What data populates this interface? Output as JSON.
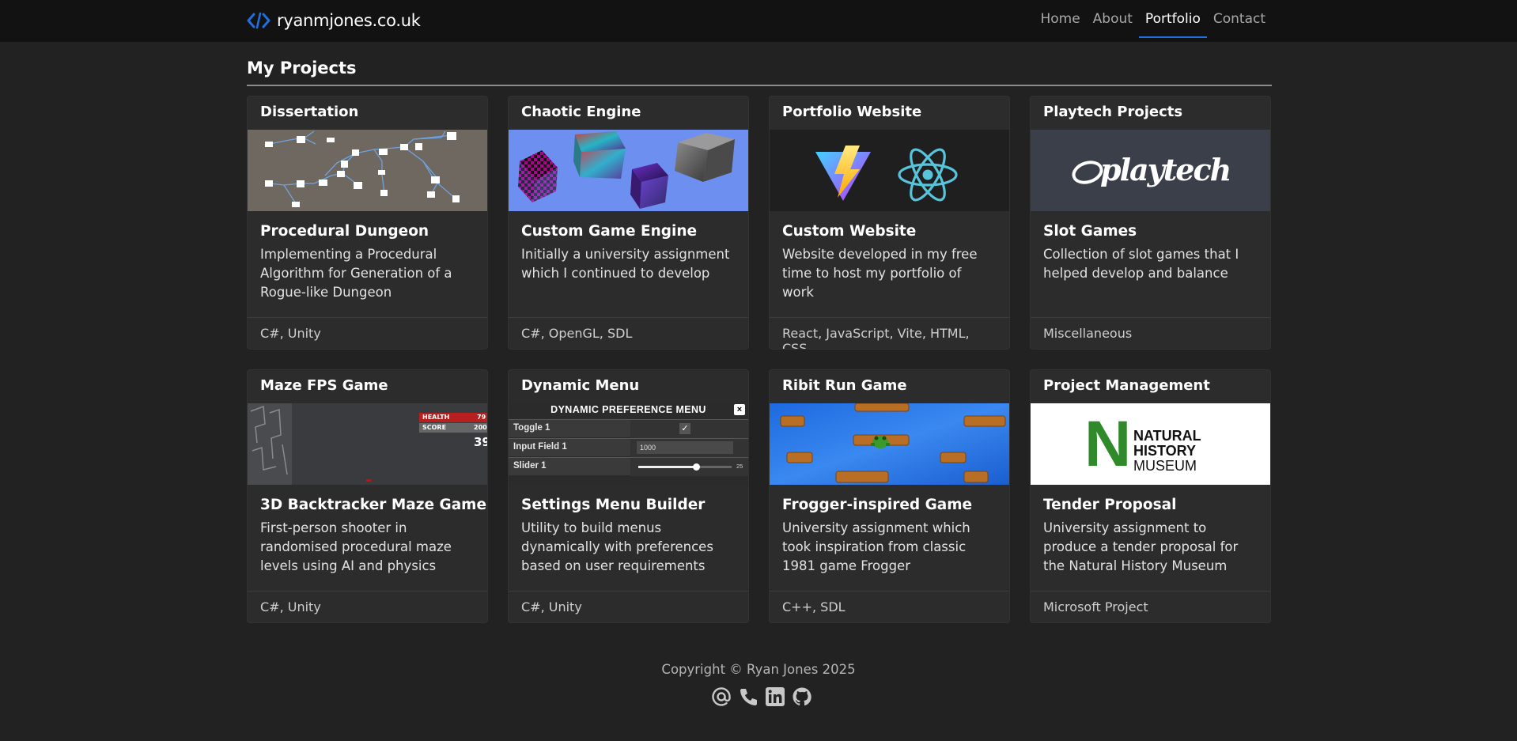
{
  "brand": {
    "name": "ryanmjones.co.uk",
    "icon": "code-icon",
    "accent": "#1f6fe0"
  },
  "nav": {
    "items": [
      {
        "label": "Home",
        "active": false
      },
      {
        "label": "About",
        "active": false
      },
      {
        "label": "Portfolio",
        "active": true
      },
      {
        "label": "Contact",
        "active": false
      }
    ]
  },
  "page": {
    "title": "My Projects"
  },
  "projects": [
    {
      "header": "Dissertation",
      "title": "Procedural Dungeon",
      "text": "Implementing a Procedural Algorithm for Generation of a Rogue-like Dungeon",
      "tags": "C#, Unity"
    },
    {
      "header": "Chaotic Engine",
      "title": "Custom Game Engine",
      "text": "Initially a university assignment which I continued to develop",
      "tags": "C#, OpenGL, SDL"
    },
    {
      "header": "Portfolio Website",
      "title": "Custom Website",
      "text": "Website developed in my free time to host my portfolio of work",
      "tags": "React, JavaScript, Vite, HTML, CSS"
    },
    {
      "header": "Playtech Projects",
      "title": "Slot Games",
      "text": "Collection of slot games that I helped develop and balance",
      "tags": "Miscellaneous",
      "logo_text": "playtech"
    },
    {
      "header": "Maze FPS Game",
      "title": "3D Backtracker Maze Game",
      "text": "First-person shooter in randomised procedural maze levels using AI and physics",
      "tags": "C#, Unity",
      "hud": {
        "health_label": "HEALTH",
        "health": "79",
        "score_label": "SCORE",
        "score": "200",
        "ammo": "39"
      }
    },
    {
      "header": "Dynamic Menu",
      "title": "Settings Menu Builder",
      "text": "Utility to build menus dynamically with preferences based on user requirements",
      "tags": "C#, Unity",
      "menu": {
        "title": "DYNAMIC PREFERENCE MENU",
        "toggle_label": "Toggle 1",
        "input_label": "Input Field 1",
        "input_value": "1000",
        "slider_label": "Slider 1",
        "slider_value": "25",
        "slider_fraction": 0.62
      }
    },
    {
      "header": "Ribit Run Game",
      "title": "Frogger-inspired Game",
      "text": "University assignment which took inspiration from classic 1981 game Frogger",
      "tags": "C++, SDL"
    },
    {
      "header": "Project Management",
      "title": "Tender Proposal",
      "text": "University assignment to produce a tender proposal for the Natural History Museum",
      "tags": "Microsoft Project",
      "logo": {
        "letter": "N",
        "line1": "NATURAL",
        "line2": "HISTORY",
        "line3": "MUSEUM"
      }
    }
  ],
  "footer": {
    "copyright": "Copyright © Ryan Jones 2025",
    "socials": [
      "at-sign-icon",
      "phone-icon",
      "linkedin-icon",
      "github-icon"
    ]
  }
}
